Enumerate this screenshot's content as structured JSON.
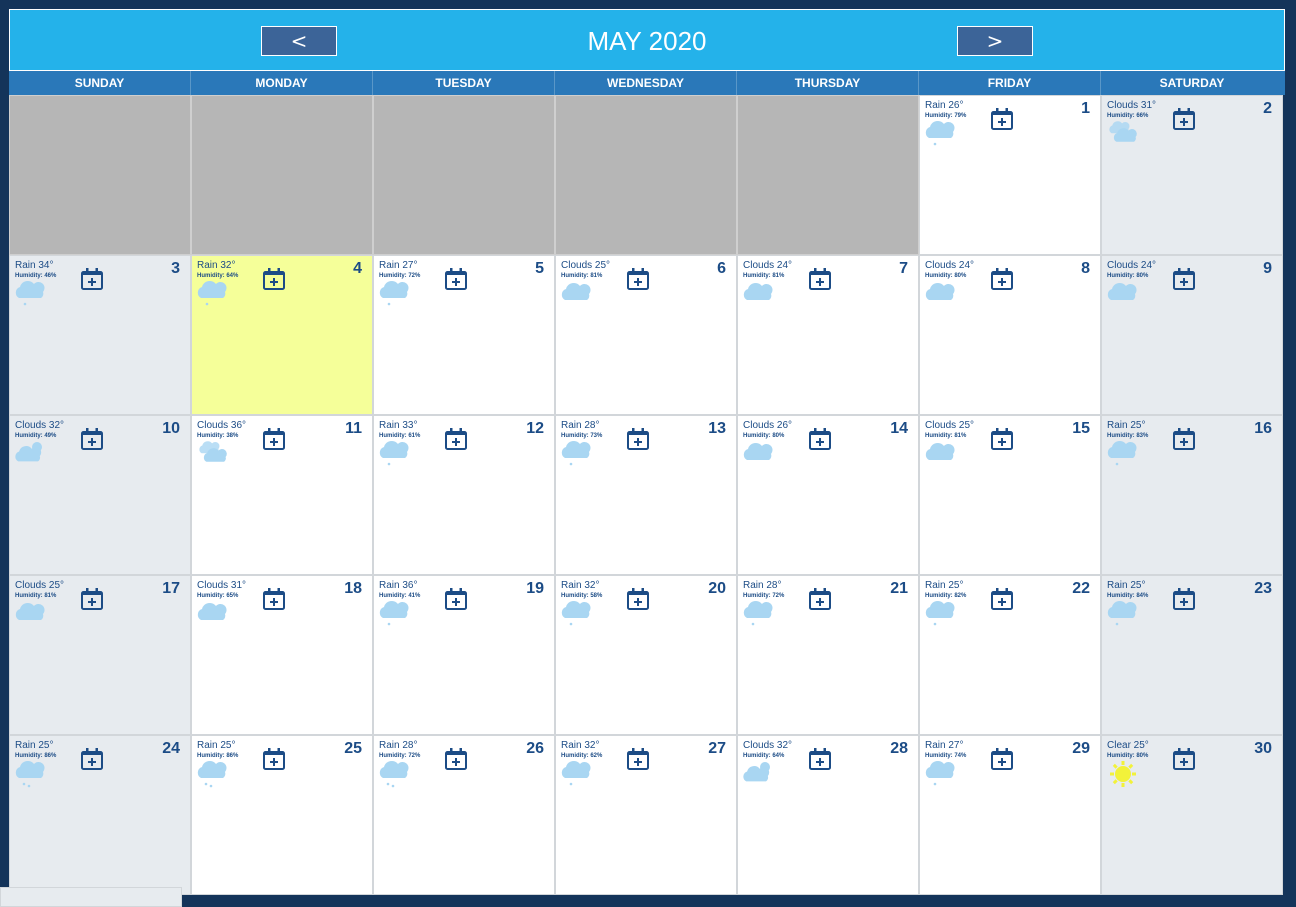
{
  "header": {
    "title": "MAY 2020",
    "prev_label": "<",
    "next_label": ">"
  },
  "weekdays": [
    "SUNDAY",
    "MONDAY",
    "TUESDAY",
    "WEDNESDAY",
    "THURSDAY",
    "FRIDAY",
    "SATURDAY"
  ],
  "colors": {
    "header_bg": "#24b2ea",
    "weekday_bar": "#2a78b9",
    "page_bg": "#14345a",
    "today_highlight": "#f5ff99",
    "blank_cell": "#b6b6b6",
    "weekend_cell": "#e7ebef",
    "text": "#1c4c86",
    "cloud": "#a9d6f2",
    "sun": "#f2f23a"
  },
  "leading_blank_days": 5,
  "today": 4,
  "days": [
    {
      "day": "1",
      "condition": "Rain 26°",
      "humidity": "Humidity: 79%",
      "icon": "rain-cloud-icon"
    },
    {
      "day": "2",
      "condition": "Clouds 31°",
      "humidity": "Humidity: 66%",
      "icon": "broken-clouds-icon"
    },
    {
      "day": "3",
      "condition": "Rain 34°",
      "humidity": "Humidity: 46%",
      "icon": "rain-cloud-icon"
    },
    {
      "day": "4",
      "condition": "Rain 32°",
      "humidity": "Humidity: 64%",
      "icon": "rain-cloud-icon"
    },
    {
      "day": "5",
      "condition": "Rain 27°",
      "humidity": "Humidity: 72%",
      "icon": "rain-cloud-icon"
    },
    {
      "day": "6",
      "condition": "Clouds 25°",
      "humidity": "Humidity: 81%",
      "icon": "cloud-icon"
    },
    {
      "day": "7",
      "condition": "Clouds 24°",
      "humidity": "Humidity: 81%",
      "icon": "cloud-icon"
    },
    {
      "day": "8",
      "condition": "Clouds 24°",
      "humidity": "Humidity: 80%",
      "icon": "cloud-icon"
    },
    {
      "day": "9",
      "condition": "Clouds 24°",
      "humidity": "Humidity: 80%",
      "icon": "cloud-icon"
    },
    {
      "day": "10",
      "condition": "Clouds 32°",
      "humidity": "Humidity: 49%",
      "icon": "partly-cloudy-icon"
    },
    {
      "day": "11",
      "condition": "Clouds 36°",
      "humidity": "Humidity: 38%",
      "icon": "broken-clouds-icon"
    },
    {
      "day": "12",
      "condition": "Rain 33°",
      "humidity": "Humidity: 61%",
      "icon": "rain-cloud-icon"
    },
    {
      "day": "13",
      "condition": "Rain 28°",
      "humidity": "Humidity: 73%",
      "icon": "rain-cloud-icon"
    },
    {
      "day": "14",
      "condition": "Clouds 26°",
      "humidity": "Humidity: 80%",
      "icon": "cloud-icon"
    },
    {
      "day": "15",
      "condition": "Clouds 25°",
      "humidity": "Humidity: 81%",
      "icon": "cloud-icon"
    },
    {
      "day": "16",
      "condition": "Rain 25°",
      "humidity": "Humidity: 83%",
      "icon": "rain-cloud-icon"
    },
    {
      "day": "17",
      "condition": "Clouds 25°",
      "humidity": "Humidity: 81%",
      "icon": "cloud-icon"
    },
    {
      "day": "18",
      "condition": "Clouds 31°",
      "humidity": "Humidity: 65%",
      "icon": "cloud-icon"
    },
    {
      "day": "19",
      "condition": "Rain 36°",
      "humidity": "Humidity: 41%",
      "icon": "rain-cloud-icon"
    },
    {
      "day": "20",
      "condition": "Rain 32°",
      "humidity": "Humidity: 58%",
      "icon": "rain-cloud-icon"
    },
    {
      "day": "21",
      "condition": "Rain 28°",
      "humidity": "Humidity: 72%",
      "icon": "rain-cloud-icon"
    },
    {
      "day": "22",
      "condition": "Rain 25°",
      "humidity": "Humidity: 82%",
      "icon": "rain-cloud-icon"
    },
    {
      "day": "23",
      "condition": "Rain 25°",
      "humidity": "Humidity: 84%",
      "icon": "rain-cloud-icon"
    },
    {
      "day": "24",
      "condition": "Rain 25°",
      "humidity": "Humidity: 86%",
      "icon": "heavy-rain-icon"
    },
    {
      "day": "25",
      "condition": "Rain 25°",
      "humidity": "Humidity: 86%",
      "icon": "heavy-rain-icon"
    },
    {
      "day": "26",
      "condition": "Rain 28°",
      "humidity": "Humidity: 72%",
      "icon": "heavy-rain-icon"
    },
    {
      "day": "27",
      "condition": "Rain 32°",
      "humidity": "Humidity: 62%",
      "icon": "rain-cloud-icon"
    },
    {
      "day": "28",
      "condition": "Clouds 32°",
      "humidity": "Humidity: 64%",
      "icon": "partly-cloudy-icon"
    },
    {
      "day": "29",
      "condition": "Rain 27°",
      "humidity": "Humidity: 74%",
      "icon": "rain-cloud-icon"
    },
    {
      "day": "30",
      "condition": "Clear 25°",
      "humidity": "Humidity: 80%",
      "icon": "sun-icon"
    }
  ]
}
